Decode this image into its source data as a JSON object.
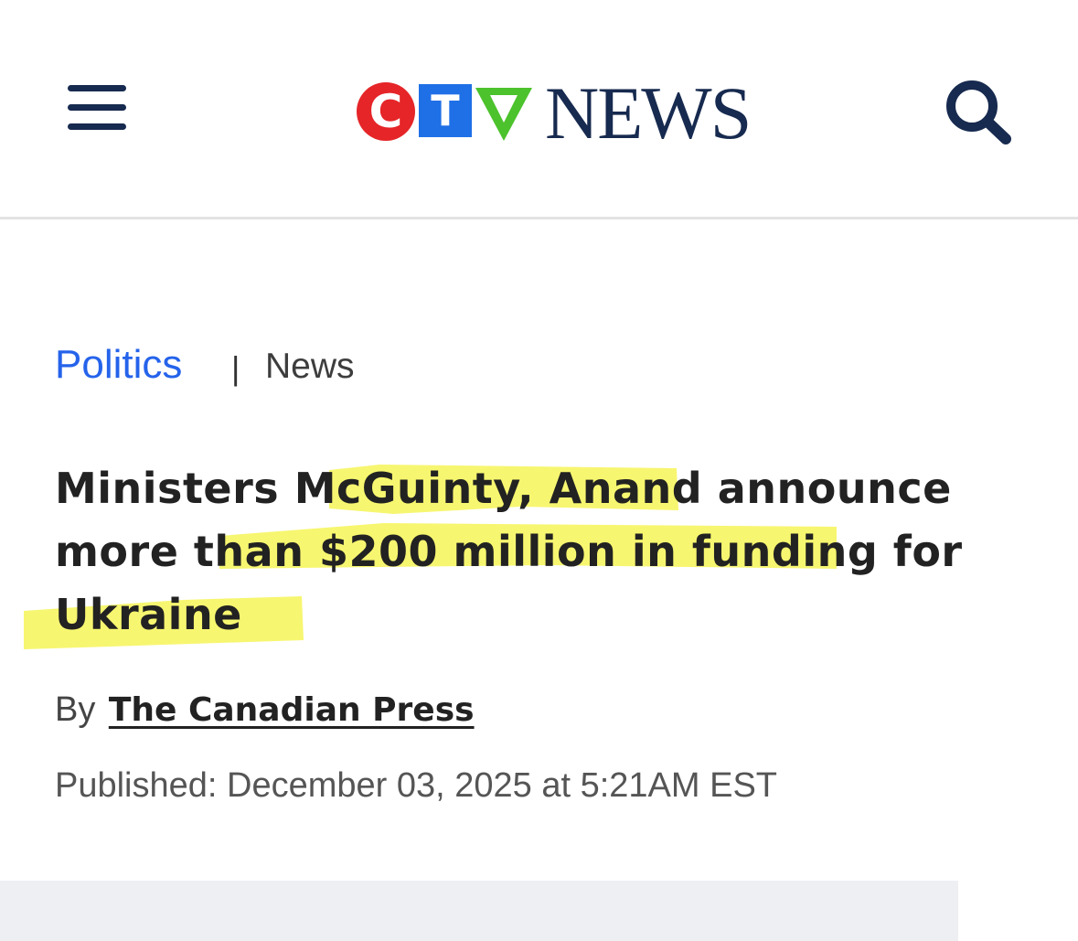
{
  "header": {
    "menu_icon": "hamburger-menu-icon",
    "search_icon": "search-icon",
    "logo": {
      "letters": [
        "C",
        "T",
        "V"
      ],
      "word": "NEWS",
      "colors": {
        "c": "#e52528",
        "t": "#1f70e6",
        "v": "#4cc22c",
        "news": "#172a4f"
      }
    }
  },
  "breadcrumb": {
    "section": "Politics",
    "separator": "|",
    "subsection": "News"
  },
  "article": {
    "headline": "Ministers McGuinty, Anand announce more than $200 million in funding for Ukraine",
    "by_label": "By",
    "author": "The Canadian Press",
    "published": "Published: December 03, 2025 at 5:21AM EST"
  },
  "colors": {
    "link_blue": "#2563eb",
    "highlight": "#f6f560",
    "navy": "#172a4f"
  }
}
